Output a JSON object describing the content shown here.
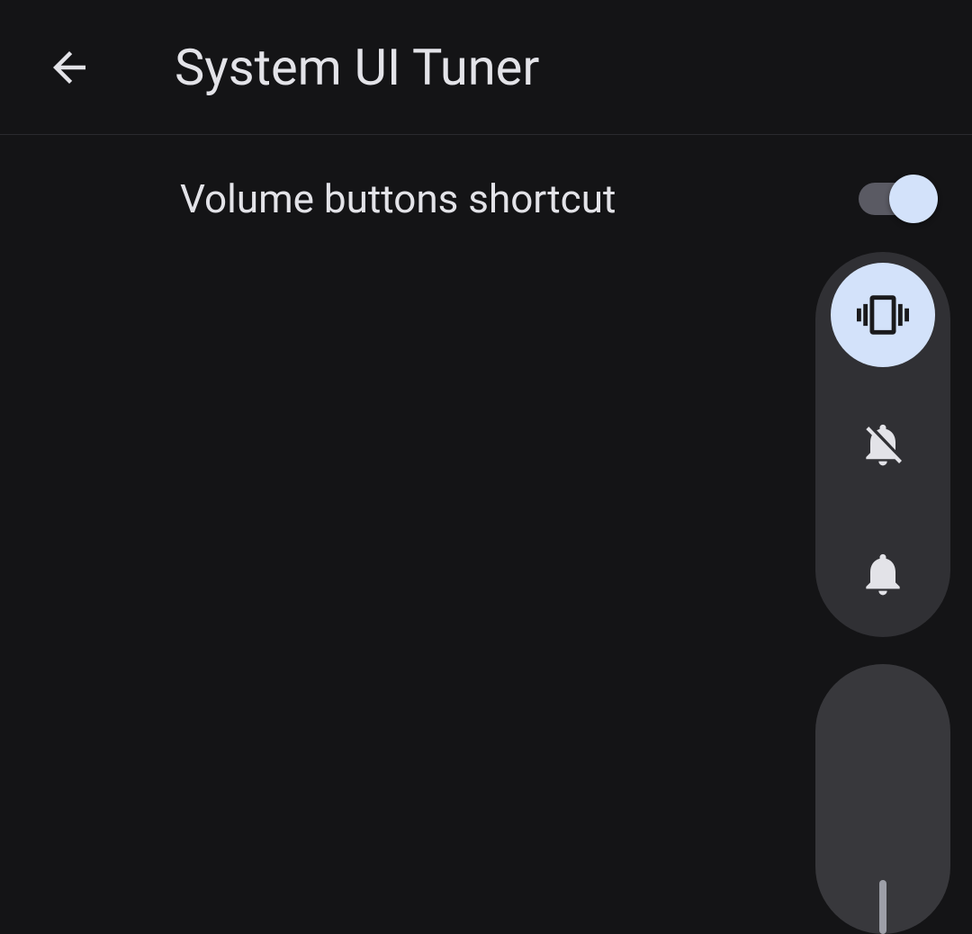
{
  "header": {
    "title": "System UI Tuner"
  },
  "settings": {
    "volume_shortcut_label": "Volume buttons shortcut",
    "volume_shortcut_enabled": true
  },
  "volume_panel": {
    "modes": [
      {
        "name": "vibrate",
        "active": true
      },
      {
        "name": "mute",
        "active": false
      },
      {
        "name": "ring",
        "active": false
      }
    ]
  }
}
